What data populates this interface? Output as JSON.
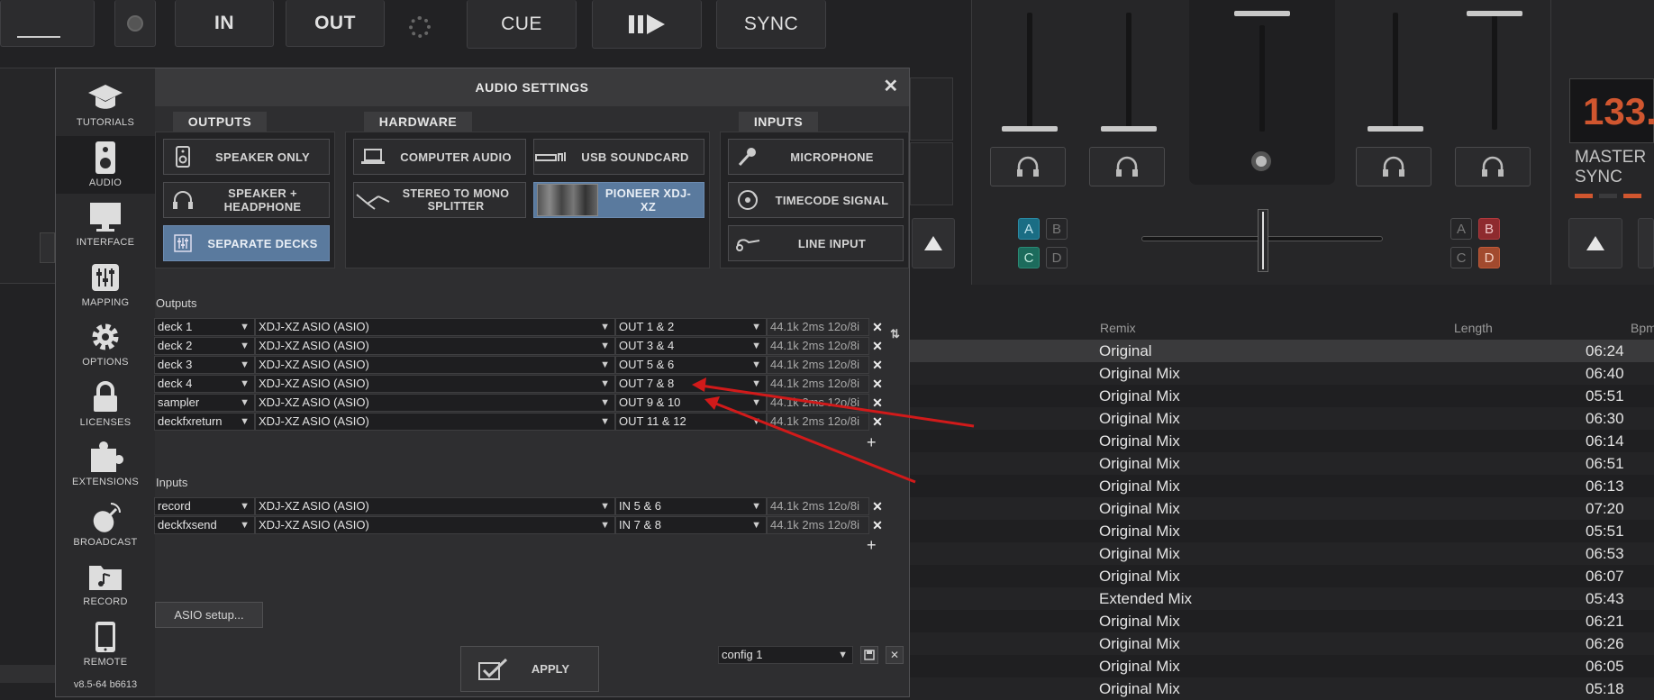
{
  "top_controls": {
    "in_label": "IN",
    "out_label": "OUT",
    "cue_label": "CUE",
    "sync_label": "SYNC"
  },
  "right_deck": {
    "bpm": "133.",
    "master_label": "MASTER",
    "sync_label": "SYNC"
  },
  "mixer": {
    "left_letters": [
      "A",
      "B",
      "C",
      "D"
    ],
    "right_letters": [
      "A",
      "B",
      "C",
      "D"
    ],
    "colors": {
      "a_teal": "#1a6d84",
      "c_green": "#1c6b5c",
      "b_red": "#8e2a2e",
      "d_orange": "#a24a2e"
    }
  },
  "browser": {
    "col_remix": "Remix",
    "col_length": "Length",
    "col_bpm": "Bpm",
    "rows": [
      {
        "remix": "Original",
        "length": "06:24"
      },
      {
        "remix": "Original Mix",
        "length": "06:40"
      },
      {
        "remix": "Original Mix",
        "length": "05:51"
      },
      {
        "remix": "Original Mix",
        "length": "06:30"
      },
      {
        "remix": "Original Mix",
        "length": "06:14"
      },
      {
        "remix": "Original Mix",
        "length": "06:51"
      },
      {
        "remix": "Original Mix",
        "length": "06:13"
      },
      {
        "remix": "Original Mix",
        "length": "07:20"
      },
      {
        "remix": "Original Mix",
        "length": "05:51"
      },
      {
        "remix": "Original Mix",
        "length": "06:53"
      },
      {
        "remix": "Original Mix",
        "length": "06:07"
      },
      {
        "remix": "Extended Mix",
        "length": "05:43"
      },
      {
        "remix": "Original Mix",
        "length": "06:21"
      },
      {
        "remix": "Original Mix",
        "length": "06:26"
      },
      {
        "remix": "Original Mix",
        "length": "06:05"
      },
      {
        "remix": "Original Mix",
        "length": "05:18"
      }
    ]
  },
  "dialog": {
    "title": "AUDIO SETTINGS",
    "close_glyph": "✕",
    "sidebar": [
      {
        "label": "TUTORIALS",
        "icon": "graduation-cap-icon"
      },
      {
        "label": "AUDIO",
        "icon": "speaker-icon"
      },
      {
        "label": "INTERFACE",
        "icon": "monitor-icon"
      },
      {
        "label": "MAPPING",
        "icon": "sliders-icon"
      },
      {
        "label": "OPTIONS",
        "icon": "gear-icon"
      },
      {
        "label": "LICENSES",
        "icon": "lock-icon"
      },
      {
        "label": "EXTENSIONS",
        "icon": "puzzle-icon"
      },
      {
        "label": "BROADCAST",
        "icon": "satellite-dish-icon"
      },
      {
        "label": "RECORD",
        "icon": "music-folder-icon"
      },
      {
        "label": "REMOTE",
        "icon": "phone-icon"
      }
    ],
    "version": "v8.5-64 b6613",
    "tabs": {
      "outputs": "OUTPUTS",
      "hardware": "HARDWARE",
      "inputs": "INPUTS"
    },
    "outputs_buttons": [
      {
        "label": "SPEAKER ONLY",
        "selected": false
      },
      {
        "label": "SPEAKER + HEADPHONE",
        "selected": false
      },
      {
        "label": "SEPARATE DECKS",
        "selected": true
      }
    ],
    "hardware_buttons": [
      {
        "label": "COMPUTER AUDIO",
        "selected": false
      },
      {
        "label": "USB SOUNDCARD",
        "selected": false
      },
      {
        "label": "STEREO TO MONO SPLITTER",
        "selected": false
      },
      {
        "label": "PIONEER XDJ-XZ",
        "selected": true
      }
    ],
    "inputs_buttons": [
      {
        "label": "MICROPHONE"
      },
      {
        "label": "TIMECODE SIGNAL"
      },
      {
        "label": "LINE INPUT"
      }
    ],
    "outputs_section_label": "Outputs",
    "inputs_section_label": "Inputs",
    "outputs": [
      {
        "channel": "deck 1",
        "device": "XDJ-XZ ASIO (ASIO)",
        "port": "OUT 1 & 2",
        "info": "44.1k 2ms 12o/8i"
      },
      {
        "channel": "deck 2",
        "device": "XDJ-XZ ASIO (ASIO)",
        "port": "OUT 3 & 4",
        "info": "44.1k 2ms 12o/8i"
      },
      {
        "channel": "deck 3",
        "device": "XDJ-XZ ASIO (ASIO)",
        "port": "OUT 5 & 6",
        "info": "44.1k 2ms 12o/8i"
      },
      {
        "channel": "deck 4",
        "device": "XDJ-XZ ASIO (ASIO)",
        "port": "OUT 7 & 8",
        "info": "44.1k 2ms 12o/8i"
      },
      {
        "channel": "sampler",
        "device": "XDJ-XZ ASIO (ASIO)",
        "port": "OUT 9 & 10",
        "info": "44.1k 2ms 12o/8i"
      },
      {
        "channel": "deckfxreturn",
        "device": "XDJ-XZ ASIO (ASIO)",
        "port": "OUT 11 & 12",
        "info": "44.1k 2ms 12o/8i"
      }
    ],
    "inputs": [
      {
        "channel": "record",
        "device": "XDJ-XZ ASIO (ASIO)",
        "port": "IN 5 & 6",
        "info": "44.1k 2ms 12o/8i"
      },
      {
        "channel": "deckfxsend",
        "device": "XDJ-XZ ASIO (ASIO)",
        "port": "IN 7 & 8",
        "info": "44.1k 2ms 12o/8i"
      }
    ],
    "remove_glyph": "✕",
    "add_glyph": "+",
    "asio_setup_label": "ASIO setup...",
    "apply_label": "APPLY",
    "config_value": "config 1"
  }
}
